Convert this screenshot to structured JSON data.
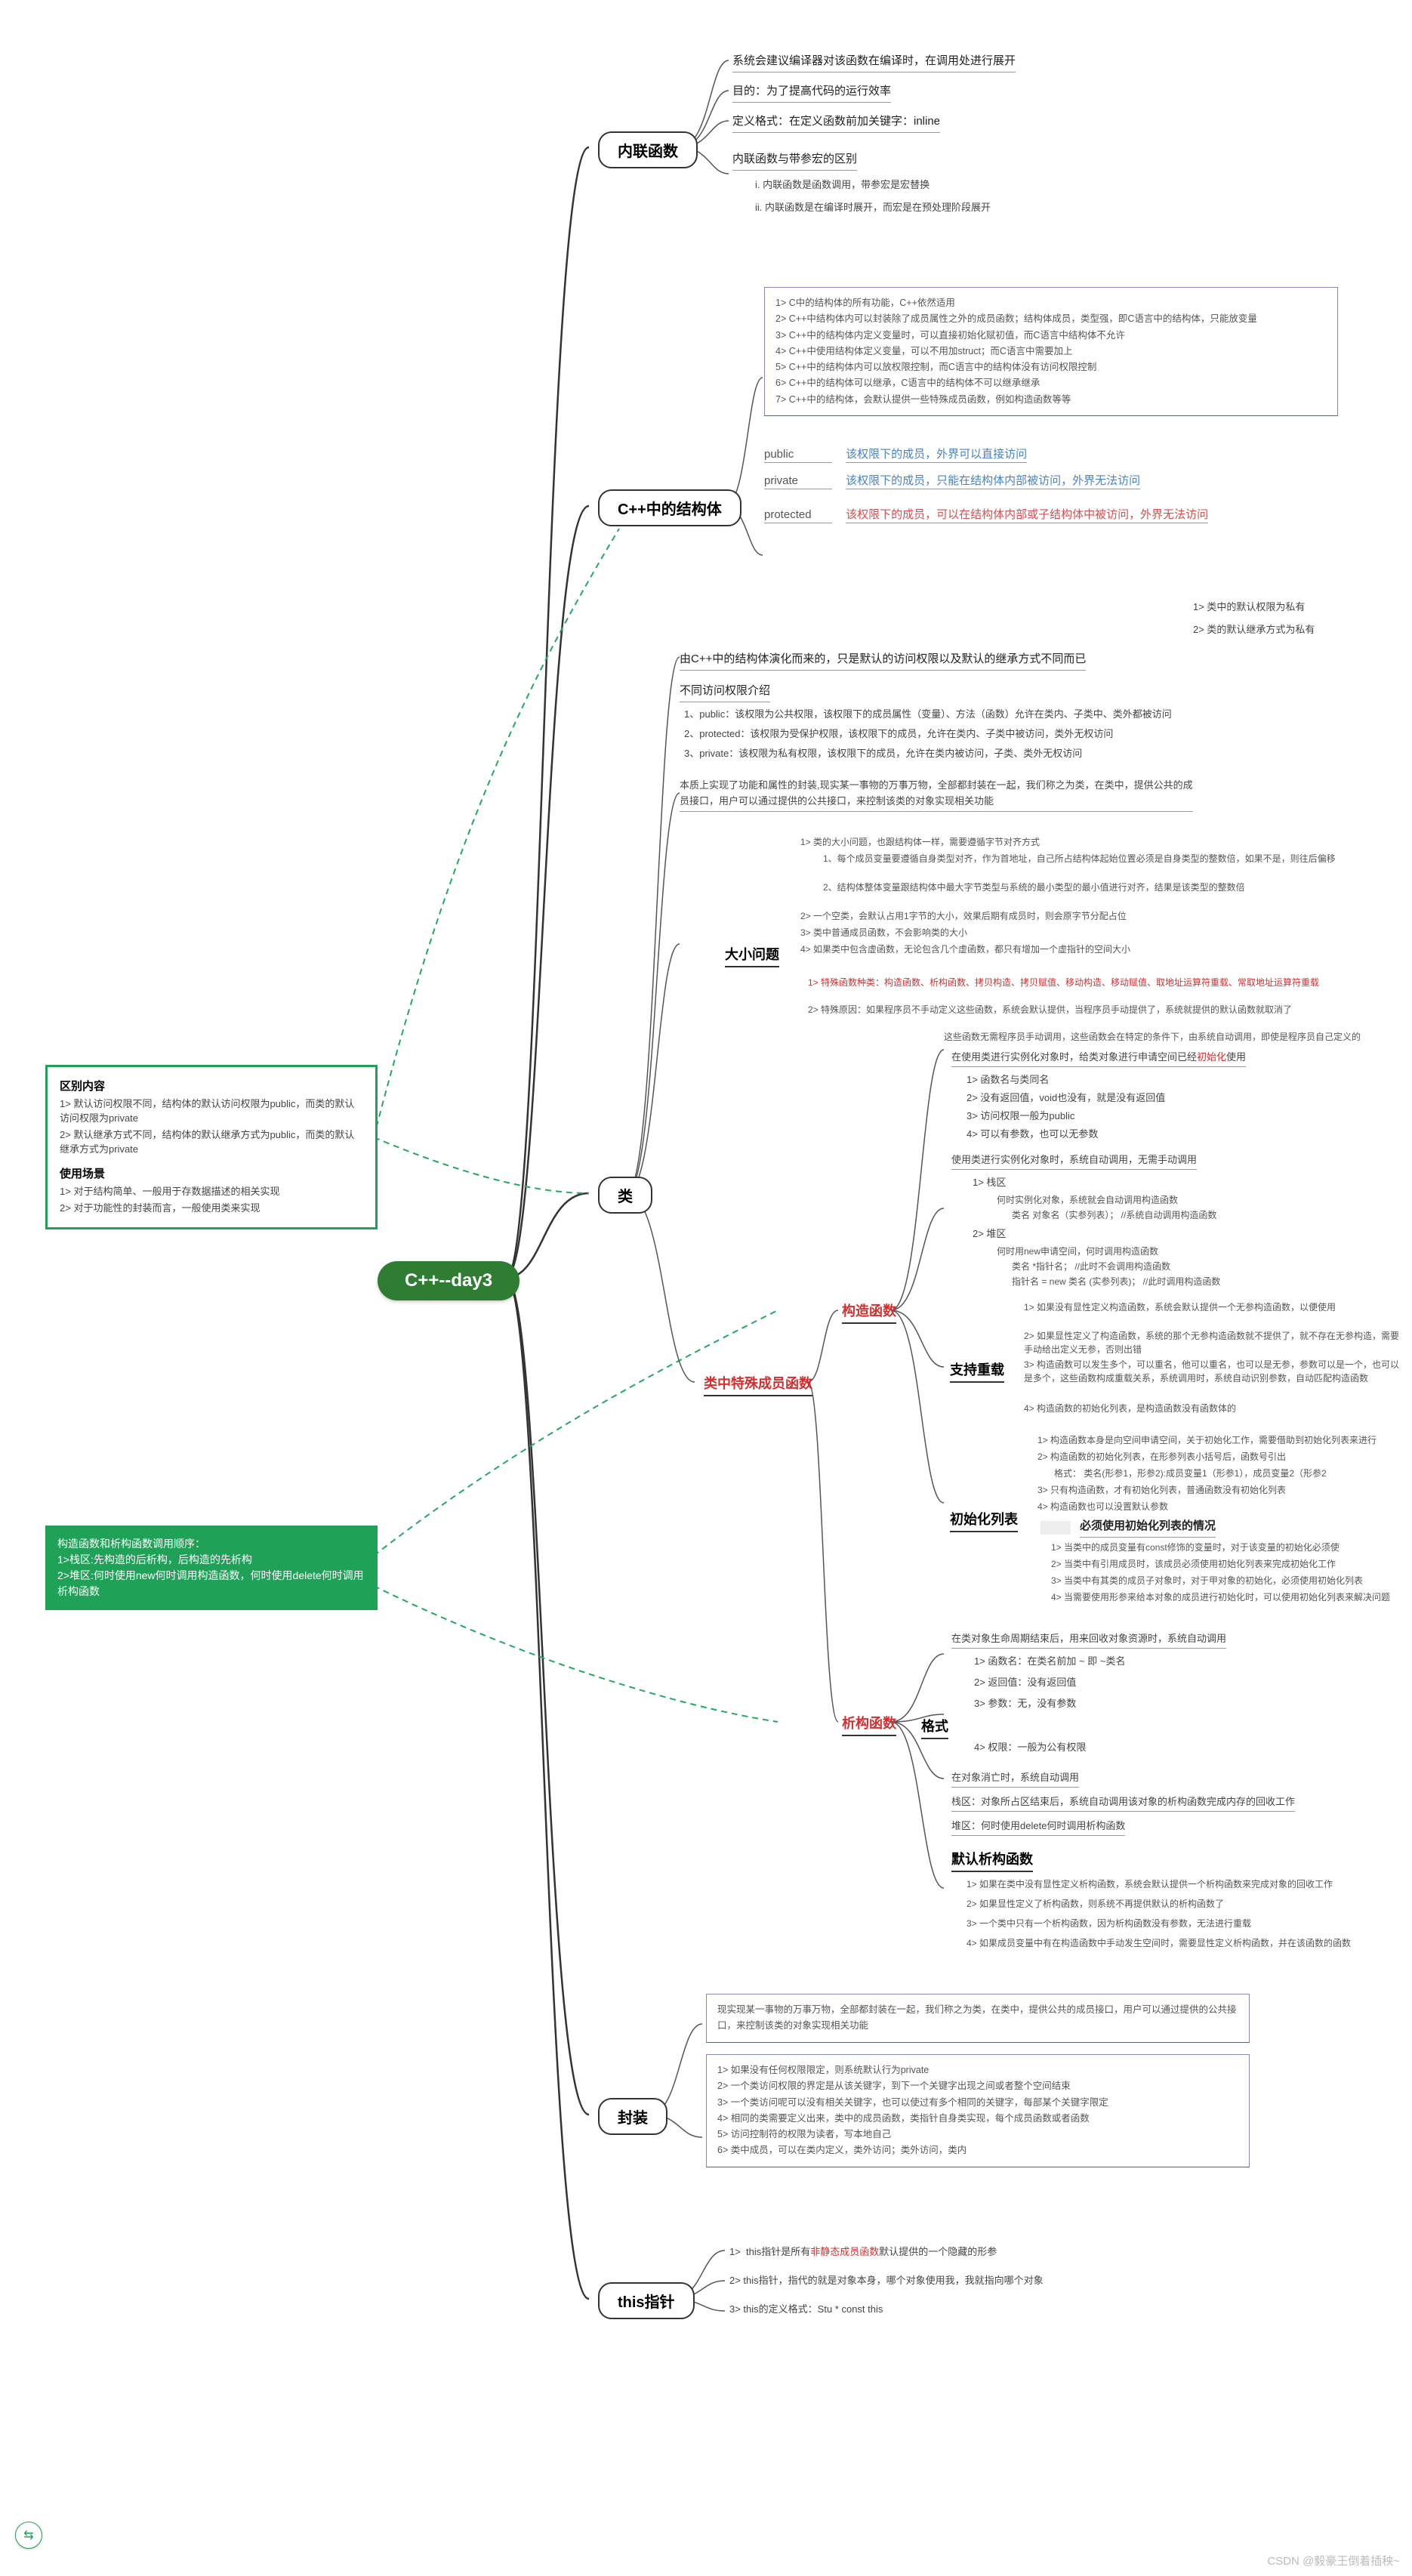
{
  "root": "C++--day3",
  "greenbox1": {
    "h1": "区别内容",
    "l1a": "默认访问权限不同，结构体的默认访问权限为public，而类的默认访问权限为private",
    "l1b": "默认继承方式不同，结构体的默认继承方式为public，而类的默认继承方式为private",
    "h2": "使用场景",
    "l2a": "对于结构简单、一般用于存数据描述的相关实现",
    "l2b": "对于功能性的封装而言，一般使用类来实现"
  },
  "greenbox2": {
    "l1": "构造函数和析构函数调用顺序：",
    "l2": "1>栈区:先构造的后析构，后构造的先析构",
    "l3": "2>堆区:何时使用new何时调用构造函数，何时使用delete何时调用析构函数"
  },
  "topic1": {
    "title": "内联函数",
    "l0": "系统会建议编译器对该函数在编译时，在调用处进行展开",
    "l1": "目的：为了提高代码的运行效率",
    "l2": "定义格式：在定义函数前加关键字：inline",
    "l3": "内联函数与带参宏的区别",
    "l3a": "i.  内联函数是函数调用，带参宏是宏替换",
    "l3b": "ii. 内联函数是在编译时展开，而宏是在预处理阶段展开"
  },
  "topic2": {
    "title": "C++中的结构体",
    "box": [
      "1>  C中的结构体的所有功能，C++依然适用",
      "2>  C++中结构体内可以封装除了成员属性之外的成员函数；结构体成员，类型强，即C语言中的结构体，只能放变量",
      "3>  C++中的结构体内定义变量时，可以直接初始化赋初值，而C语言中结构体不允许",
      "4>  C++中使用结构体定义变量，可以不用加struct；而C语言中需要加上",
      "5>  C++中的结构体内可以放权限控制，而C语言中的结构体没有访问权限控制",
      "6>  C++中的结构体可以继承，C语言中的结构体不可以继承继承",
      "7>  C++中的结构体，会默认提供一些特殊成员函数，例如构造函数等等"
    ],
    "acc": [
      {
        "k": "public",
        "v": "该权限下的成员，外界可以直接访问"
      },
      {
        "k": "private",
        "v": "该权限下的成员，只能在结构体内部被访问，外界无法访问"
      },
      {
        "k": "protected",
        "v": "该权限下的成员，可以在结构体内部或子结构体中被访问，外界无法访问"
      }
    ]
  },
  "topic3": {
    "title": "类",
    "intro": "由C++中的结构体演化而来的，只是默认的访问权限以及默认的继承方式不同而已",
    "r1": "1>  类中的默认权限为私有",
    "r2": "2>  类的默认继承方式为私有",
    "permHdr": "不同访问权限介绍",
    "perm": [
      "1、public：该权限为公共权限，该权限下的成员属性（变量）、方法（函数）允许在类内、子类中、类外都被访问",
      "2、protected：该权限为受保护权限，该权限下的成员，允许在类内、子类中被访问，类外无权访问",
      "3、private：该权限为私有权限，该权限下的成员，允许在类内被访问，子类、类外无权访问"
    ],
    "bridge": "本质上实现了功能和属性的封装,现实某一事物的万事万物，全部都封装在一起，我们称之为类，在类中，提供公共的成员接口，用户可以通过提供的公共接口，来控制该类的对象实现相关功能",
    "sizeHdr": "大小问题",
    "size": [
      "1>  类的大小问题，也跟结构体一样，需要遵循字节对齐方式",
      "   1、每个成员变量要遵循自身类型对齐，作为首地址，自己所占结构体起始位置必须是自身类型的整数倍，如果不是，则往后偏移",
      "   2、结构体整体变量跟结构体中最大字节类型与系统的最小类型的最小值进行对齐，结果是该类型的整数倍",
      "2>  一个空类，会默认占用1字节的大小，效果后期有成员时，则会原字节分配占位",
      "3>  类中普通成员函数，不会影响类的大小",
      "4>  如果类中包含虚函数，无论包含几个虚函数，都只有增加一个虚指针的空间大小"
    ],
    "specialHdr": "类中特殊成员函数",
    "specialNote1": "1>  特殊函数种类：构造函数、析构函数、拷贝构造、拷贝赋值、移动构造、移动赋值、取地址运算符重载、常取地址运算符重载",
    "specialNote2": "2>  特殊原因：如果程序员不手动定义这些函数，系统会默认提供，当程序员手动提供了，系统就提供的默认函数就取消了",
    "specialNote3": "这些函数无需程序员手动调用，这些函数会在特定的条件下，由系统自动调用，即使是程序员自己定义的"
  },
  "ctor": {
    "title": "构造函数",
    "l0": "在使用类进行实例化对象时，给类对象进行申请空间已经初始化使用",
    "ls": [
      "1>  函数名与类同名",
      "2>  没有返回值，void也没有，就是没有返回值",
      "3>  访问权限一般为public",
      "4>  可以有参数，也可以无参数"
    ],
    "call0": "使用类进行实例化对象时，系统自动调用，无需手动调用",
    "call_stack": "1>  栈区",
    "call_stack_sub": "何时实例化对象，系统就会自动调用构造函数",
    "call_stack_sub2": "类名  对象名（实参列表）；    //系统自动调用构造函数",
    "call_heap": "2>  堆区",
    "call_heap_sub": "何时用new申请空间，何时调用构造函数",
    "call_heap_sub2": "类名  *指针名；       //此时不会调用构造函数",
    "call_heap_sub3": "指针名 = new  类名  (实参列表)；  //此时调用构造函数",
    "overloadHdr": "支持重载",
    "overload": [
      "1>  如果没有显性定义构造函数，系统会默认提供一个无参构造函数，以便使用",
      "2>  如果显性定义了构造函数，系统的那个无参构造函数就不提供了，就不存在无参构造，需要手动给出定义无参，否则出错",
      "3>  构造函数可以发生多个，可以重名，他可以重名，也可以是无参，参数可以是一个，也可以是多个，这些函数构成重载关系，系统调用时，系统自动识别参数，自动匹配构造函数",
      "4>  构造函数的初始化列表，是构造函数没有函数体的"
    ],
    "initlistHdr": "初始化列表",
    "initlist": [
      "1>  构造函数本身是向空间申请空间，关于初始化工作，需要借助到初始化列表来进行",
      "2>  构造函数的初始化列表，在形参列表小括号后，函数号引出",
      "   格式：  类名(形参1，形参2):成员变量1（形参1），成员变量2（形参2",
      "3>  只有构造函数，才有初始化列表，普通函数没有初始化列表",
      "4>  构造函数也可以没置默认参数"
    ],
    "mustHdr": "必须使用初始化列表的情况",
    "must": [
      "1>  当类中的成员变量有const修饰的变量时，对于该变量的初始化必须使",
      "2>  当类中有引用成员时，该成员必须使用初始化列表来完成初始化工作",
      "3>  当类中有其类的成员子对象时，对于甲对象的初始化，必须使用初始化列表",
      "4>  当需要使用形参来给本对象的成员进行初始化时，可以使用初始化列表来解决问题"
    ]
  },
  "dtor": {
    "title": "析构函数",
    "l0": "在类对象生命周期结束后，用来回收对象资源时，系统自动调用",
    "ls": [
      "1>  函数名：在类名前加 ~ 即 ~类名",
      "2>  返回值：没有返回值",
      "3>  参数：无，没有参数",
      "4>  权限：一般为公有权限"
    ],
    "fmtHdr": "格式",
    "call1": "在对象消亡时，系统自动调用",
    "call2": "栈区：对象所占区结束后，系统自动调用该对象的析构函数完成内存的回收工作",
    "call3": "堆区：何时使用delete何时调用析构函数",
    "defaultHdr": "默认析构函数",
    "default": [
      "1>  如果在类中没有显性定义析构函数，系统会默认提供一个析构函数来完成对象的回收工作",
      "2>  如果显性定义了析构函数，则系统不再提供默认的析构函数了",
      "3>  一个类中只有一个析构函数，因为析构函数没有参数，无法进行重载",
      "4>  如果成员变量中有在构造函数中手动发生空间时，需要显性定义析构函数，并在该函数的函数"
    ]
  },
  "encap": {
    "title": "封装",
    "l0": "现实现某一事物的万事万物，全部都封装在一起，我们称之为类，在类中，提供公共的成员接口，用户可以通过提供的公共接口，来控制该类的对象实现相关功能",
    "ls": [
      "1>  如果没有任何权限限定，则系统默认行为private",
      "2>  一个类访问权限的界定是从该关键字，到下一个关键字出现之间或者整个空间结束",
      "3>  一个类访问呢可以没有相关关键字，也可以使过有多个相同的关键字，每部某个关键字限定",
      "4>  相同的类需要定义出来，类中的成员函数，类指针自身类实现，每个成员函数或者函数",
      "5>  访问控制符的权限为读者，写本地自己",
      "6>  类中成员，可以在类内定义，类外访问；类外访问，类内"
    ]
  },
  "thisptr": {
    "title": "this指针",
    "ls": [
      "1>  this指针是所有非静态成员函数默认提供的一个隐藏的形参",
      "2>  this指针，指代的就是对象本身，哪个对象使用我，我就指向哪个对象",
      "3>  this的定义格式：Stu * const this"
    ]
  },
  "watermark": "CSDN @毅豪王倒着插秧~",
  "float": "⇆"
}
